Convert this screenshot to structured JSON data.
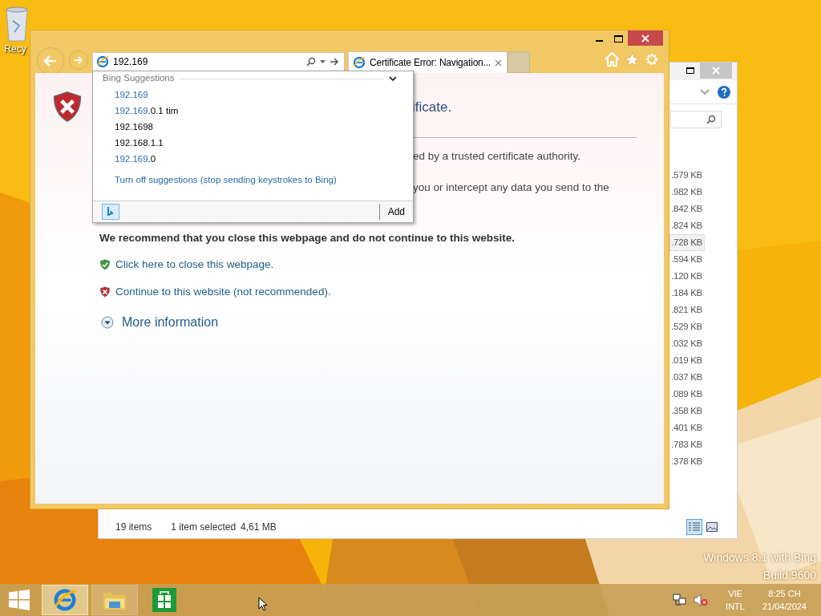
{
  "desktop": {
    "icons": [
      {
        "label": "Recy"
      }
    ],
    "watermark": [
      "Windows 8.1 with Bing",
      "Build 9600"
    ]
  },
  "explorer": {
    "sizes": [
      {
        "text": ".579 KB",
        "selected": false
      },
      {
        "text": ".982 KB",
        "selected": false
      },
      {
        "text": ".842 KB",
        "selected": false
      },
      {
        "text": ".824 KB",
        "selected": false
      },
      {
        "text": ".728 KB",
        "selected": true
      },
      {
        "text": ".594 KB",
        "selected": false
      },
      {
        "text": ".120 KB",
        "selected": false
      },
      {
        "text": ".184 KB",
        "selected": false
      },
      {
        "text": ".821 KB",
        "selected": false
      },
      {
        "text": ".529 KB",
        "selected": false
      },
      {
        "text": ".032 KB",
        "selected": false
      },
      {
        "text": ".019 KB",
        "selected": false
      },
      {
        "text": ".037 KB",
        "selected": false
      },
      {
        "text": ".089 KB",
        "selected": false
      },
      {
        "text": ".358 KB",
        "selected": false
      },
      {
        "text": ".401 KB",
        "selected": false
      },
      {
        "text": ".783 KB",
        "selected": false
      },
      {
        "text": ".378 KB",
        "selected": false
      }
    ],
    "status": {
      "items": "19 items",
      "selection": "1 item selected",
      "size": "4,61 MB"
    },
    "view_buttons": [
      {
        "kind": "details",
        "selected": true
      },
      {
        "kind": "thumbnails",
        "selected": false
      }
    ]
  },
  "browser": {
    "address": "192.169",
    "tabs": [
      {
        "title": "Certificate Error: Navigation...",
        "selected": true
      }
    ],
    "suggestions": {
      "header": "Bing Suggestions",
      "items": [
        {
          "match": "192.169"
        },
        {
          "match": "192.169",
          "rest": ".0.1 tim"
        },
        {
          "rest": "192.1698"
        },
        {
          "rest": "192.168.1.1"
        },
        {
          "match": "192.169",
          "rest": ".0"
        }
      ],
      "turn_off": "Turn off suggestions (stop sending keystrokes to Bing)",
      "add": "Add"
    },
    "page": {
      "title": "ificate.",
      "lines": [
        "ed by a trusted certificate authority.",
        "you or intercept any data you send to the"
      ],
      "recommendation": "We recommend that you close this webpage and do not continue to this website.",
      "actions": [
        {
          "kind": "safe",
          "text": "Click here to close this webpage."
        },
        {
          "kind": "unsafe",
          "text": "Continue to this website (not recommended)."
        }
      ],
      "more": "More information"
    }
  },
  "taskbar": {
    "apps": [
      {
        "kind": "ie",
        "selected": true
      },
      {
        "kind": "explorer",
        "selected": false
      },
      {
        "kind": "store",
        "selected": false
      }
    ],
    "language": [
      "VIE",
      "INTL"
    ],
    "time": "8:25 CH",
    "date": "21/04/2024"
  }
}
